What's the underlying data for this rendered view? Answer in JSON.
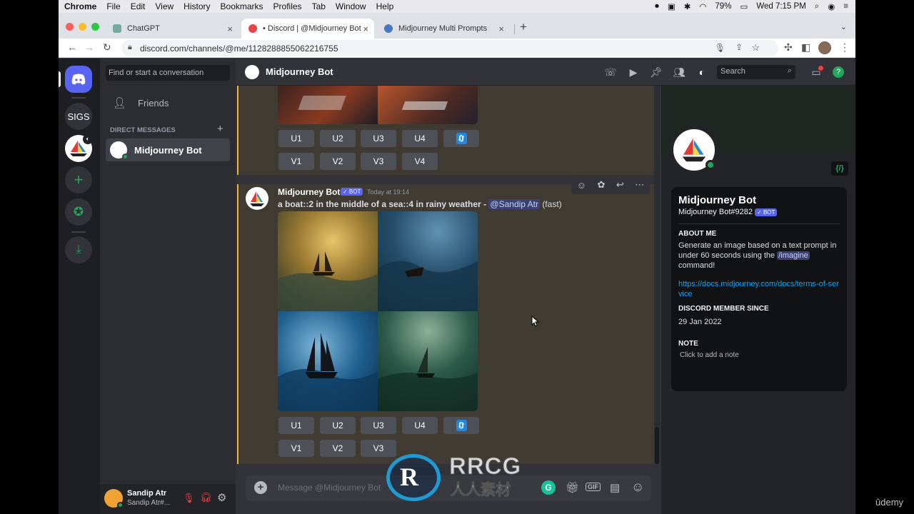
{
  "mac": {
    "menu": [
      "Chrome",
      "File",
      "Edit",
      "View",
      "History",
      "Bookmarks",
      "Profiles",
      "Tab",
      "Window",
      "Help"
    ],
    "battery": "79%",
    "clock": "Wed 7:15 PM"
  },
  "browser": {
    "tabs": [
      {
        "label": "ChatGPT"
      },
      {
        "label": "• Discord | @Midjourney Bot"
      },
      {
        "label": "Midjourney Multi Prompts"
      }
    ],
    "url": "discord.com/channels/@me/1128288855062216755"
  },
  "discord": {
    "servers": {
      "sigs": "SIGS"
    },
    "dm_search_placeholder": "Find or start a conversation",
    "friends": "Friends",
    "direct_messages": "DIRECT MESSAGES",
    "dm_entry": "Midjourney Bot",
    "user": {
      "name": "Sandip Atr",
      "tag": "Sandip Atr#..."
    },
    "header_title": "Midjourney Bot",
    "header_search": "Search",
    "messages": [
      {
        "buttons_row1": [
          "U1",
          "U2",
          "U3",
          "U4"
        ],
        "buttons_row2": [
          "V1",
          "V2",
          "V3",
          "V4"
        ]
      },
      {
        "author": "Midjourney Bot",
        "badge": "✓ BOT",
        "time": "Today at 19:14",
        "prompt": "a boat::2 in the middle of a sea::4 in rainy weather -",
        "mention": "@Sandip Atr",
        "mode": "(fast)",
        "buttons_row1": [
          "U1",
          "U2",
          "U3",
          "U4"
        ],
        "buttons_row2": [
          "V1",
          "V2",
          "V3"
        ]
      }
    ],
    "composer_placeholder": "Message @Midjourney Bot",
    "profile": {
      "name": "Midjourney Bot",
      "tag": "Midjourney Bot#9282",
      "badge": "✓ BOT",
      "about_heading": "ABOUT ME",
      "about_text_1": "Generate an image based on a text prompt in under 60 seconds using the",
      "about_command": "/imagine",
      "about_text_2": "command!",
      "link": "https://docs.midjourney.com/docs/terms-of-service",
      "member_heading": "DISCORD MEMBER SINCE",
      "member_since": "29 Jan 2022",
      "note_heading": "NOTE",
      "note_placeholder": "Click to add a note"
    }
  },
  "overlay": {
    "watermark_brand": "RRCG",
    "watermark_sub": "人人素材",
    "udemy": "ûdemy"
  }
}
